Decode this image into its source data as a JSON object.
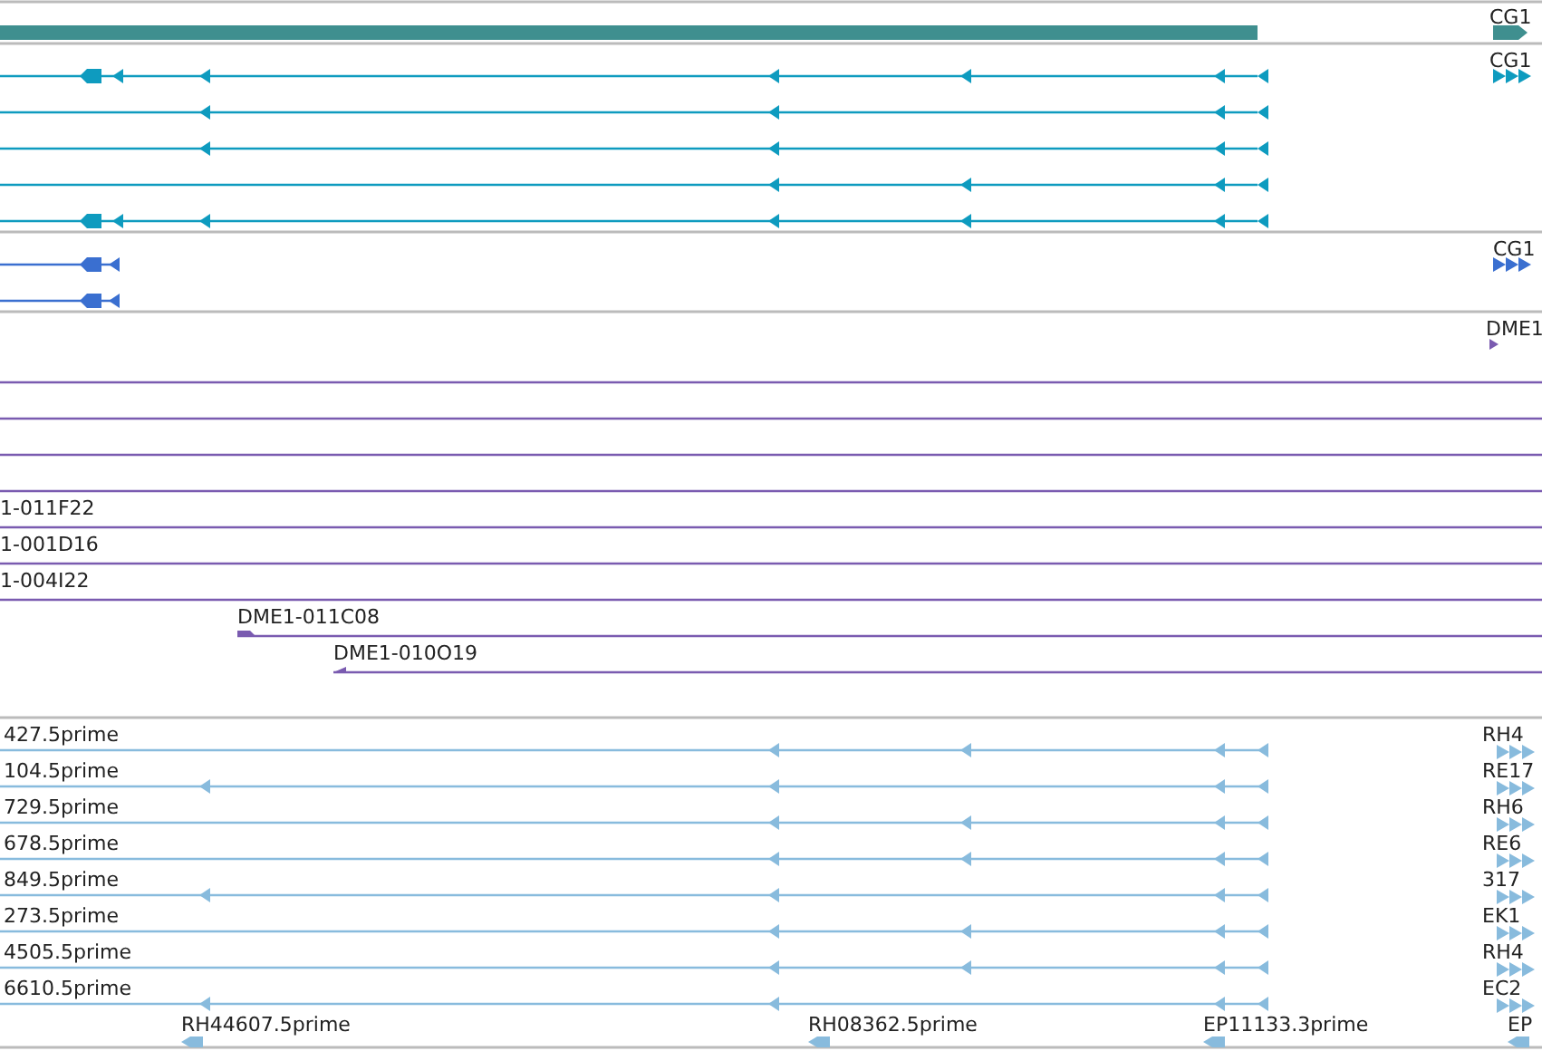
{
  "tracks": [
    {
      "kind": "gene",
      "color": "#3f8f8f",
      "label": "CG1"
    },
    {
      "kind": "transcripts",
      "color": "#0e9bbf",
      "label": "CG1"
    },
    {
      "kind": "transcripts",
      "color": "#3a6fd0",
      "label": "CG1"
    },
    {
      "kind": "clones",
      "color": "#7a5bb0",
      "label": "DME1",
      "rows": [
        {
          "kind": "line"
        },
        {
          "kind": "line"
        },
        {
          "kind": "line"
        },
        {
          "kind": "line"
        },
        {
          "kind": "clone",
          "label": "1-011F22"
        },
        {
          "kind": "clone",
          "label": "1-001D16"
        },
        {
          "kind": "clone",
          "label": "1-004I22"
        },
        {
          "kind": "clone",
          "label": "DME1-011C08"
        },
        {
          "kind": "clone",
          "label": "DME1-010O19"
        }
      ]
    },
    {
      "kind": "ests",
      "color": "#88bbdd",
      "rows": [
        {
          "label": "427.5prime",
          "right_label": "RH4"
        },
        {
          "label": "104.5prime",
          "right_label": "RE17"
        },
        {
          "label": "729.5prime",
          "right_label": "RH6"
        },
        {
          "label": "678.5prime",
          "right_label": "RE6"
        },
        {
          "label": "849.5prime",
          "right_label": "317"
        },
        {
          "label": "273.5prime",
          "right_label": "EK1"
        },
        {
          "label": "4505.5prime",
          "right_label": "RH4"
        },
        {
          "label": "6610.5prime",
          "right_label": "EC2"
        }
      ],
      "bottom_labels": [
        "RH44607.5prime",
        "RH08362.5prime",
        "EP11133.3prime",
        "EP"
      ]
    }
  ]
}
